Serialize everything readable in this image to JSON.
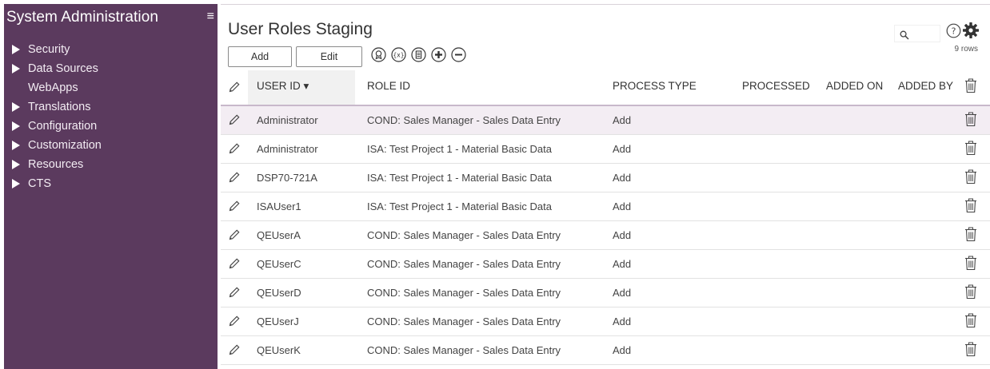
{
  "sidebar": {
    "title": "System Administration",
    "menu_icon": "hamburger-icon",
    "items": [
      {
        "label": "Security",
        "expandable": true
      },
      {
        "label": "Data Sources",
        "expandable": true
      },
      {
        "label": "WebApps",
        "expandable": false
      },
      {
        "label": "Translations",
        "expandable": true
      },
      {
        "label": "Configuration",
        "expandable": true
      },
      {
        "label": "Customization",
        "expandable": true
      },
      {
        "label": "Resources",
        "expandable": true
      },
      {
        "label": "CTS",
        "expandable": true
      }
    ]
  },
  "page": {
    "title": "User Roles Staging",
    "add_label": "Add",
    "edit_label": "Edit",
    "rows_count": "9 rows",
    "search_placeholder": ""
  },
  "table": {
    "headers": {
      "user_id": "USER ID ▾",
      "role_id": "ROLE ID",
      "process_type": "PROCESS TYPE",
      "processed": "PROCESSED",
      "added_on": "ADDED ON",
      "added_by": "ADDED BY"
    },
    "rows": [
      {
        "user_id": "Administrator",
        "role_id": "COND: Sales Manager - Sales Data Entry",
        "process_type": "Add"
      },
      {
        "user_id": "Administrator",
        "role_id": "ISA: Test Project 1 - Material Basic Data",
        "process_type": "Add"
      },
      {
        "user_id": "DSP70-721A",
        "role_id": "ISA: Test Project 1 - Material Basic Data",
        "process_type": "Add"
      },
      {
        "user_id": "ISAUser1",
        "role_id": "ISA: Test Project 1 - Material Basic Data",
        "process_type": "Add"
      },
      {
        "user_id": "QEUserA",
        "role_id": "COND: Sales Manager - Sales Data Entry",
        "process_type": "Add"
      },
      {
        "user_id": "QEUserC",
        "role_id": "COND: Sales Manager - Sales Data Entry",
        "process_type": "Add"
      },
      {
        "user_id": "QEUserD",
        "role_id": "COND: Sales Manager - Sales Data Entry",
        "process_type": "Add"
      },
      {
        "user_id": "QEUserJ",
        "role_id": "COND: Sales Manager - Sales Data Entry",
        "process_type": "Add"
      },
      {
        "user_id": "QEUserK",
        "role_id": "COND: Sales Manager - Sales Data Entry",
        "process_type": "Add"
      }
    ]
  },
  "colors": {
    "sidebar_bg": "#5b3a5e",
    "selected_row_bg": "#f3edf3",
    "header_underline": "#c8b8cb"
  }
}
